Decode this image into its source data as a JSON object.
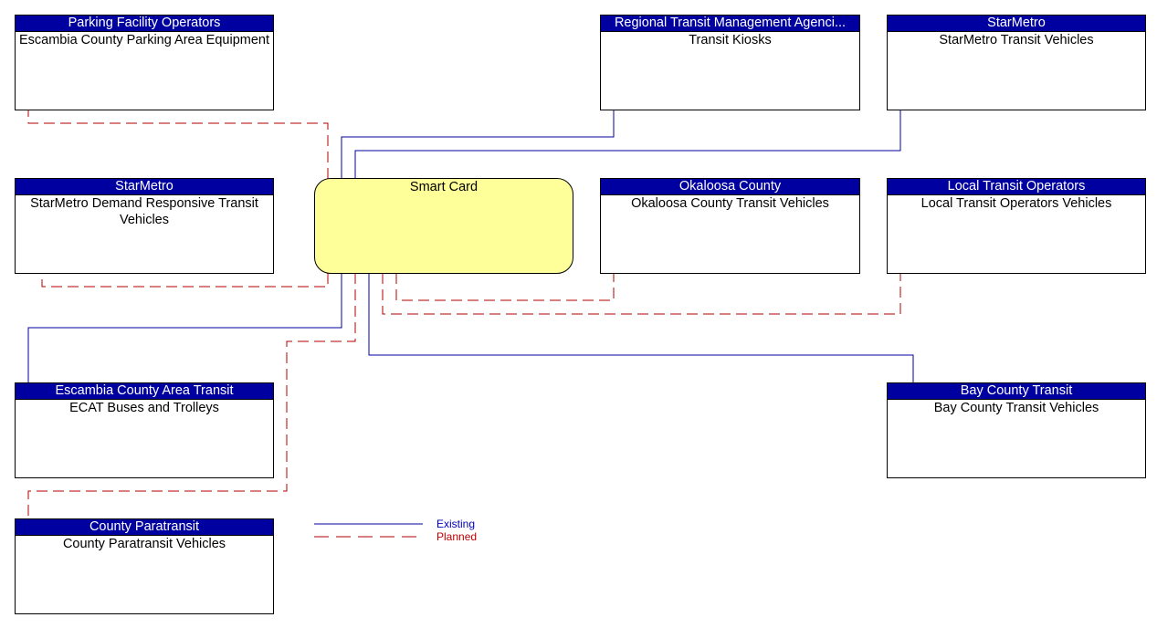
{
  "diagram": {
    "center": {
      "id": "smart-card",
      "label": "Smart Card"
    },
    "nodes": [
      {
        "id": "parking",
        "owner": "Parking Facility Operators",
        "label": "Escambia County Parking Area Equipment",
        "status": "planned"
      },
      {
        "id": "kiosks",
        "owner": "Regional Transit Management Agenci...",
        "label": "Transit Kiosks",
        "status": "existing"
      },
      {
        "id": "starmetro-transit",
        "owner": "StarMetro",
        "label": "StarMetro Transit Vehicles",
        "status": "existing"
      },
      {
        "id": "starmetro-demand",
        "owner": "StarMetro",
        "label": "StarMetro Demand Responsive Transit Vehicles",
        "status": "planned"
      },
      {
        "id": "okaloosa",
        "owner": "Okaloosa County",
        "label": "Okaloosa County Transit Vehicles",
        "status": "planned"
      },
      {
        "id": "local-transit",
        "owner": "Local Transit Operators",
        "label": "Local Transit Operators Vehicles",
        "status": "planned"
      },
      {
        "id": "ecat",
        "owner": "Escambia County Area Transit",
        "label": "ECAT Buses and Trolleys",
        "status": "existing"
      },
      {
        "id": "bay-county",
        "owner": "Bay County Transit",
        "label": "Bay County Transit Vehicles",
        "status": "existing"
      },
      {
        "id": "paratransit",
        "owner": "County Paratransit",
        "label": "County Paratransit Vehicles",
        "status": "planned"
      }
    ],
    "legend": {
      "existing": "Existing",
      "planned": "Planned"
    },
    "colors": {
      "header_bg": "#0000a0",
      "center_fill": "#ffff99",
      "existing_line": "#00009c",
      "planned_line": "#b00000"
    }
  }
}
